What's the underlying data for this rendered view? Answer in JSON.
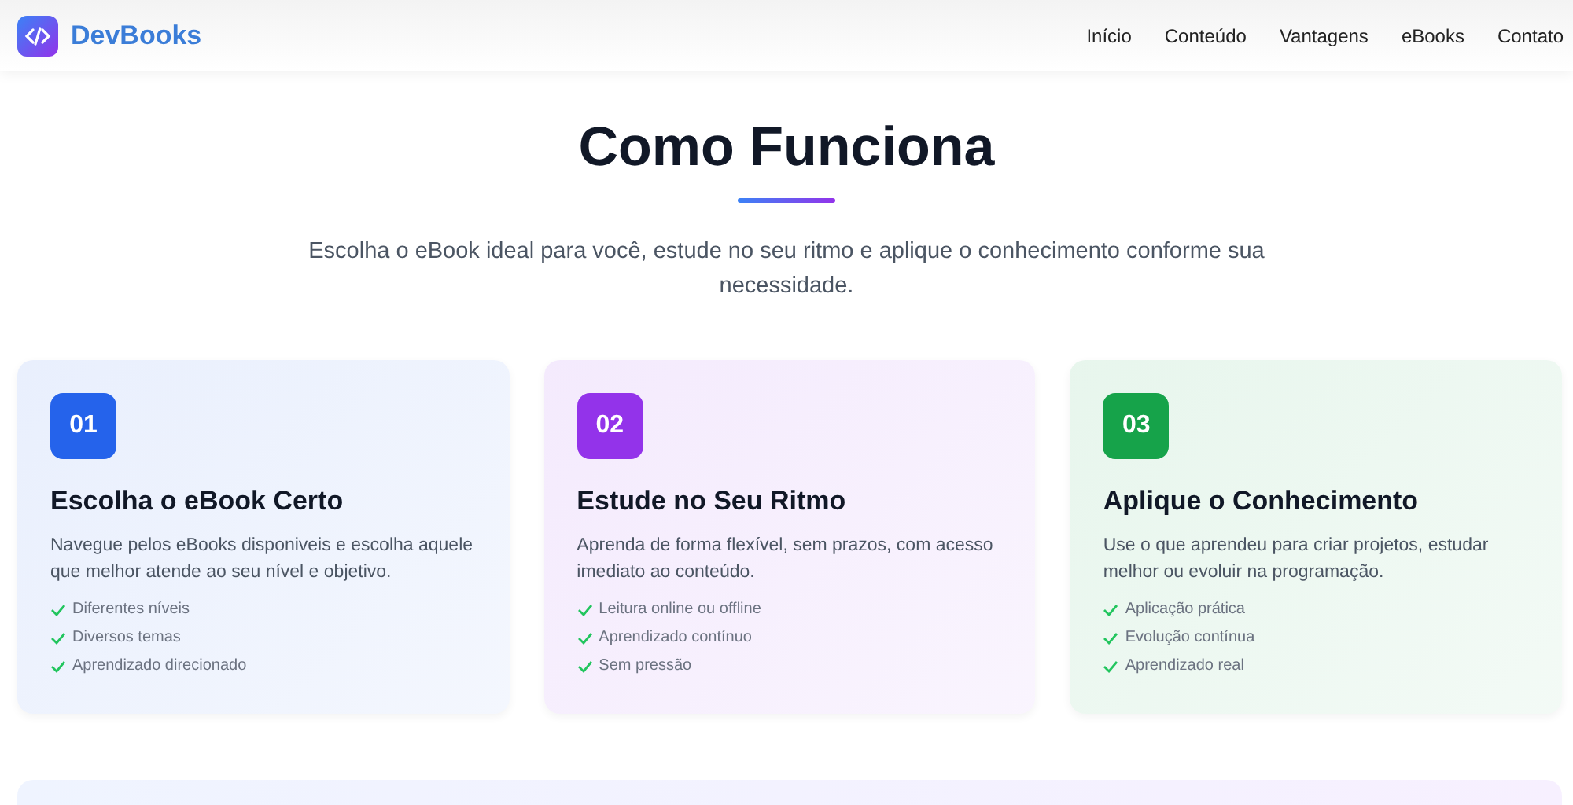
{
  "brand": {
    "name": "DevBooks"
  },
  "nav": [
    {
      "label": "Início"
    },
    {
      "label": "Conteúdo"
    },
    {
      "label": "Vantagens"
    },
    {
      "label": "eBooks"
    },
    {
      "label": "Contato"
    }
  ],
  "section": {
    "title": "Como Funciona",
    "subtitle": "Escolha o eBook ideal para você, estude no seu ritmo e aplique o conhecimento conforme sua necessidade."
  },
  "steps": [
    {
      "number": "01",
      "color": "#2563eb",
      "title": "Escolha o eBook Certo",
      "text": "Navegue pelos eBooks disponiveis e escolha aquele que melhor atende ao seu nível e objetivo.",
      "features": [
        "Diferentes níveis",
        "Diversos temas",
        "Aprendizado direcionado"
      ]
    },
    {
      "number": "02",
      "color": "#9333ea",
      "title": "Estude no Seu Ritmo",
      "text": "Aprenda de forma flexível, sem prazos, com acesso imediato ao conteúdo.",
      "features": [
        "Leitura online ou offline",
        "Aprendizado contínuo",
        "Sem pressão"
      ]
    },
    {
      "number": "03",
      "color": "#16a34a",
      "title": "Aplique o Conhecimento",
      "text": "Use o que aprendeu para criar projetos, estudar melhor ou evoluir na programação.",
      "features": [
        "Aplicação prática",
        "Evolução contínua",
        "Aprendizado real"
      ]
    }
  ]
}
